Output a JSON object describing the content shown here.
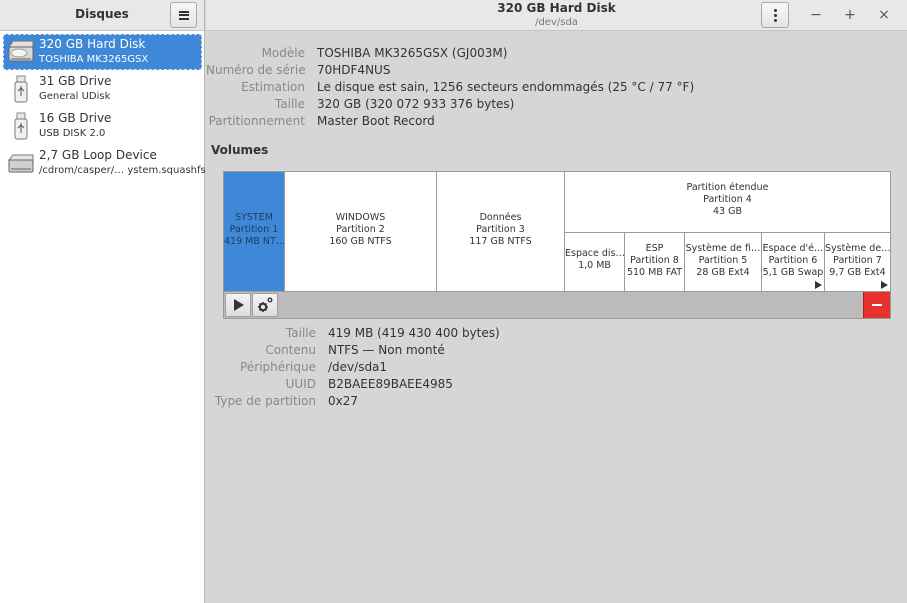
{
  "sidebar": {
    "title": "Disques",
    "drives": [
      {
        "name": "320 GB Hard Disk",
        "sub": "TOSHIBA MK3265GSX",
        "icon": "hard-disk-icon",
        "selected": true
      },
      {
        "name": "31 GB Drive",
        "sub": "General UDisk",
        "icon": "usb-drive-icon",
        "selected": false
      },
      {
        "name": "16 GB Drive",
        "sub": "USB DISK 2.0",
        "icon": "usb-drive-icon",
        "selected": false
      },
      {
        "name": "2,7 GB Loop Device",
        "sub": "/cdrom/casper/… ystem.squashfs",
        "icon": "loop-device-icon",
        "selected": false
      }
    ]
  },
  "header": {
    "title": "320 GB Hard Disk",
    "subtitle": "/dev/sda",
    "minimize": "−",
    "maximize": "+",
    "close": "×"
  },
  "disk_info": [
    {
      "label": "Modèle",
      "value": "TOSHIBA MK3265GSX (GJ003M)"
    },
    {
      "label": "Numéro de série",
      "value": "70HDF4NUS"
    },
    {
      "label": "Estimation",
      "value": "Le disque est sain, 1256 secteurs endommagés (25 °C / 77 °F)"
    },
    {
      "label": "Taille",
      "value": "320 GB (320 072 933 376 bytes)"
    },
    {
      "label": "Partitionnement",
      "value": "Master Boot Record"
    }
  ],
  "volumes": {
    "title": "Volumes",
    "partitions": [
      {
        "name": "SYSTEM",
        "part": "Partition 1",
        "size": "419 MB NT…",
        "selected": true
      },
      {
        "name": "WINDOWS",
        "part": "Partition 2",
        "size": "160 GB NTFS"
      },
      {
        "name": "Données",
        "part": "Partition 3",
        "size": "117 GB NTFS"
      },
      {
        "name": "Partition étendue",
        "part": "Partition 4",
        "size": "43 GB"
      }
    ],
    "logical": [
      {
        "name": "Espace dis…",
        "size": "1,0 MB"
      },
      {
        "name": "ESP",
        "part": "Partition 8",
        "size": "510 MB FAT"
      },
      {
        "name": "Système de fi…",
        "part": "Partition 5",
        "size": "28 GB Ext4"
      },
      {
        "name": "Espace d'é…",
        "part": "Partition 6",
        "size": "5,1 GB Swap"
      },
      {
        "name": "Système de…",
        "part": "Partition 7",
        "size": "9,7 GB Ext4"
      }
    ]
  },
  "volume_info": [
    {
      "label": "Taille",
      "value": "419 MB (419 430 400 bytes)"
    },
    {
      "label": "Contenu",
      "value": "NTFS — Non monté"
    },
    {
      "label": "Périphérique",
      "value": "/dev/sda1"
    },
    {
      "label": "UUID",
      "value": "B2BAEE89BAEE4985"
    },
    {
      "label": "Type de partition",
      "value": "0x27"
    }
  ],
  "colors": {
    "accent": "#3f88d8",
    "danger": "#e8322e"
  }
}
